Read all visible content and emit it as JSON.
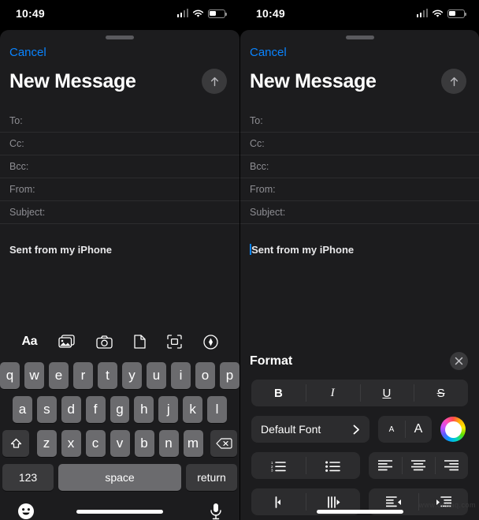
{
  "status_bar": {
    "time": "10:49",
    "cellular_icon": "cellular-signal-icon",
    "wifi_icon": "wifi-icon",
    "battery_icon": "battery-icon"
  },
  "compose": {
    "cancel_label": "Cancel",
    "title": "New Message",
    "send_icon": "send-arrow-up-icon",
    "fields": [
      {
        "label": "To:",
        "value": ""
      },
      {
        "label": "Cc:",
        "value": ""
      },
      {
        "label": "Bcc:",
        "value": ""
      },
      {
        "label": "From:",
        "value": ""
      },
      {
        "label": "Subject:",
        "value": ""
      }
    ],
    "body_text": "Sent from my iPhone"
  },
  "attachment_toolbar": {
    "items": [
      {
        "label": "Aa",
        "name": "format-text-icon"
      },
      {
        "label": "",
        "name": "photo-library-icon"
      },
      {
        "label": "",
        "name": "camera-icon"
      },
      {
        "label": "",
        "name": "document-icon"
      },
      {
        "label": "",
        "name": "scan-document-icon"
      },
      {
        "label": "",
        "name": "markup-pen-icon"
      }
    ]
  },
  "keyboard": {
    "row1": [
      "q",
      "w",
      "e",
      "r",
      "t",
      "y",
      "u",
      "i",
      "o",
      "p"
    ],
    "row2": [
      "a",
      "s",
      "d",
      "f",
      "g",
      "h",
      "j",
      "k",
      "l"
    ],
    "row3": [
      "z",
      "x",
      "c",
      "v",
      "b",
      "n",
      "m"
    ],
    "shift_icon": "shift-up-arrow-icon",
    "delete_icon": "backspace-delete-icon",
    "numbers_label": "123",
    "space_label": "space",
    "return_label": "return",
    "emoji_icon": "emoji-smiley-icon",
    "dictation_icon": "microphone-icon"
  },
  "format_panel": {
    "title": "Format",
    "close_icon": "close-x-icon",
    "style_buttons": [
      {
        "label": "B",
        "name": "bold-button"
      },
      {
        "label": "I",
        "name": "italic-button"
      },
      {
        "label": "U",
        "name": "underline-button"
      },
      {
        "label": "S",
        "name": "strikethrough-button"
      }
    ],
    "font_name": "Default Font",
    "font_chevron_icon": "chevron-right-icon",
    "size_small_label": "A",
    "size_large_label": "A",
    "color_wheel_icon": "color-wheel-icon",
    "list_buttons": [
      {
        "name": "numbered-list-button"
      },
      {
        "name": "bulleted-list-button"
      }
    ],
    "align_buttons": [
      {
        "name": "align-left-button"
      },
      {
        "name": "align-center-button"
      },
      {
        "name": "align-right-button"
      }
    ],
    "direction_buttons": [
      {
        "name": "text-direction-ltr-button"
      },
      {
        "name": "text-direction-rtl-button"
      }
    ],
    "indent_buttons": [
      {
        "name": "decrease-indent-button"
      },
      {
        "name": "increase-indent-button"
      }
    ]
  },
  "watermark": "www.deuaq.com"
}
